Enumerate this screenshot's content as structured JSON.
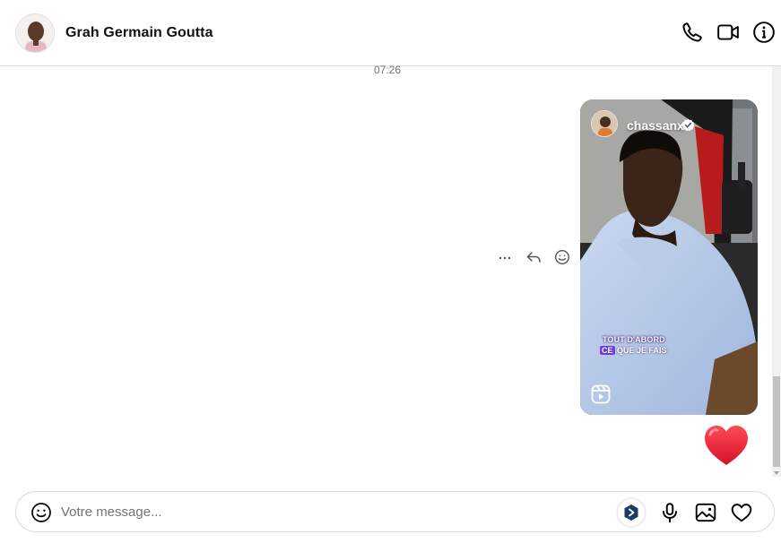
{
  "header": {
    "contact_name": "Grah Germain Goutta",
    "icons": [
      "phone-icon",
      "video-camera-icon",
      "info-icon"
    ]
  },
  "thread": {
    "timestamp": "07:26",
    "shared_reel": {
      "username": "chassanx",
      "verified": true,
      "caption_line1": "TOUT D'ABORD",
      "caption_highlight": "CE",
      "caption_rest": "QUE JE FAIS",
      "media_icon": "reels-icon"
    },
    "message_actions": [
      "more-icon",
      "reply-icon",
      "emoji-react-icon"
    ],
    "reaction": "heart"
  },
  "composer": {
    "placeholder": "Votre message...",
    "value": "",
    "icons": [
      "emoji-icon",
      "extension-icon",
      "microphone-icon",
      "image-icon",
      "heart-icon"
    ]
  },
  "colors": {
    "border": "#dbdbdb",
    "secondary_text": "#737373",
    "heart": "#e4263a",
    "highlight": "#7b3fe4"
  }
}
